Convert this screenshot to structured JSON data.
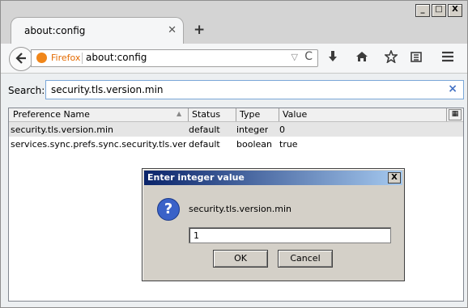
{
  "window": {
    "minimize_label": "_",
    "maximize_label": "□",
    "close_label": "X"
  },
  "tab": {
    "title": "about:config",
    "close_label": "✕",
    "new_tab_label": "+"
  },
  "navbar": {
    "identity_label": "Firefox",
    "url": "about:config",
    "dropdown_glyph": "▽",
    "reload_glyph": "C"
  },
  "search": {
    "label": "Search:",
    "value": "security.tls.version.min",
    "clear_glyph": "×"
  },
  "table": {
    "columns": [
      "Preference Name",
      "Status",
      "Type",
      "Value"
    ],
    "rows": [
      {
        "name": "security.tls.version.min",
        "status": "default",
        "type": "integer",
        "value": "0"
      },
      {
        "name": "services.sync.prefs.sync.security.tls.versi…",
        "status": "default",
        "type": "boolean",
        "value": "true"
      }
    ]
  },
  "dialog": {
    "title": "Enter integer value",
    "close_label": "X",
    "message": "security.tls.version.min",
    "input_value": "1",
    "ok_label": "OK",
    "cancel_label": "Cancel"
  },
  "icons": {
    "back": "back-arrow-icon",
    "download": "download-icon",
    "home": "home-icon",
    "bookmark": "star-icon",
    "reading_list": "reading-list-icon",
    "menu": "hamburger-icon",
    "question": "question-icon"
  },
  "colors": {
    "dialog_title_start": "#0a246a",
    "dialog_title_end": "#a6caf0",
    "firefox_orange": "#f0861a",
    "selected_row": "#e5e5e5"
  }
}
